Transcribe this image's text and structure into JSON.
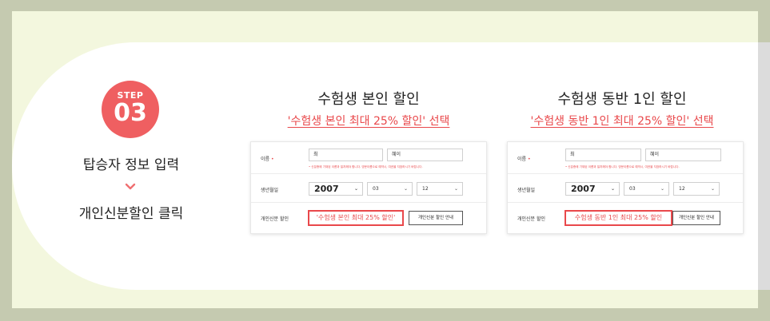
{
  "step": {
    "label": "STEP",
    "number": "03"
  },
  "left": {
    "title": "탑승자 정보 입력",
    "action": "개인신분할인 클릭"
  },
  "columns": [
    {
      "title": "수험생 본인 할인",
      "subtitle": "'수험생 본인 최대 25% 할인' 선택",
      "form": {
        "name_label": "이름",
        "last_name": "최",
        "first_name": "혜이",
        "note": "• 신분증에 기재된 이름과 일치해야 합니다. 영문이름으로 예약시, 여권을 지참하시기 바랍니다.",
        "birth_label": "생년월일",
        "year": "2007",
        "month": "03",
        "day": "12",
        "discount_label": "개인신분 할인",
        "discount_value": "'수험생 본인 최대 25% 할인'",
        "info_button": "개인신분 할인 안내"
      }
    },
    {
      "title": "수험생 동반 1인 할인",
      "subtitle": "'수험생 동반 1인 최대 25% 할인' 선택",
      "form": {
        "name_label": "이름",
        "last_name": "최",
        "first_name": "혜이",
        "note": "• 신분증에 기재된 이름과 일치해야 합니다. 영문이름으로 예약시, 여권을 지참하시기 바랍니다.",
        "birth_label": "생년월일",
        "year": "2007",
        "month": "03",
        "day": "12",
        "discount_label": "개인신분 할인",
        "discount_value": "수험생 동반 1인 최대 25% 할인",
        "info_button": "개인신분 할인 안내"
      }
    }
  ],
  "colors": {
    "accent": "#e9484b",
    "badge": "#ef5f61",
    "background": "#c5cab0",
    "banner": "#f3f7de"
  }
}
